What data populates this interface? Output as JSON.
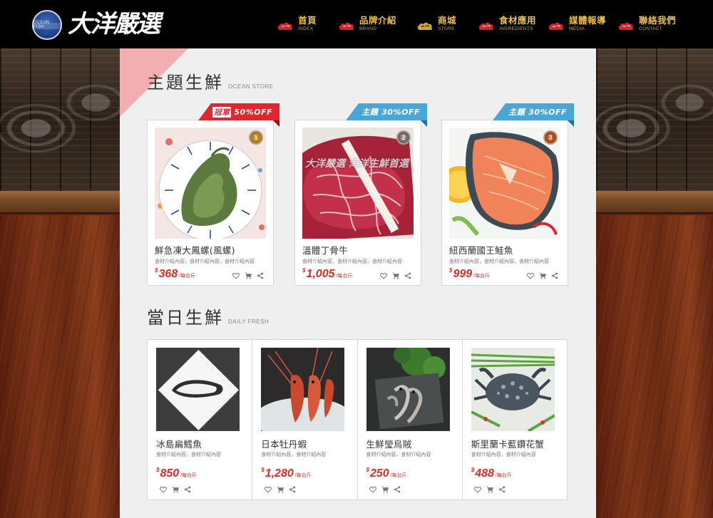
{
  "header": {
    "logo_badge_text": "OCEAN FISH",
    "logo_text": "大洋嚴選",
    "nav": [
      {
        "zh": "首頁",
        "en": "INDEX",
        "cloud": "red"
      },
      {
        "zh": "品牌介紹",
        "en": "BRAND",
        "cloud": "red"
      },
      {
        "zh": "商城",
        "en": "STORE",
        "cloud": "gold"
      },
      {
        "zh": "食材應用",
        "en": "INGREDIENTS",
        "cloud": "red"
      },
      {
        "zh": "媒體報導",
        "en": "MEDIA",
        "cloud": "red"
      },
      {
        "zh": "聯絡我們",
        "en": "CONTACT",
        "cloud": "red"
      }
    ]
  },
  "theme_section": {
    "title_zh": "主題生鮮",
    "title_en": "OCEAN STORE",
    "cards": [
      {
        "ribbon_prefix": "冠軍",
        "ribbon_text": "50%OFF",
        "ribbon_color": "#e0262f",
        "rank": "1",
        "name": "鮮急凍大鳳螺(風螺)",
        "desc": "食材介紹內容，食材介紹內容，食材介紹內容",
        "price": "368",
        "currency": "$",
        "unit": "/每台斤"
      },
      {
        "ribbon_prefix": "主題",
        "ribbon_text": "30%OFF",
        "ribbon_color": "#4aa6d6",
        "rank": "2",
        "name": "溫體丁骨牛",
        "desc": "食材介紹內容，食材介紹內容，食材介紹內容",
        "price": "1,005",
        "currency": "$",
        "unit": "/每台斤",
        "watermark": "大洋嚴選 海洋生鮮首選"
      },
      {
        "ribbon_prefix": "主題",
        "ribbon_text": "30%OFF",
        "ribbon_color": "#4aa6d6",
        "rank": "3",
        "name": "紐西蘭國王鮭魚",
        "desc": "食材介紹內容，食材介紹內容，食材介紹內容",
        "price": "999",
        "currency": "$",
        "unit": "/每台斤"
      }
    ]
  },
  "daily_section": {
    "title_zh": "當日生鮮",
    "title_en": "DAILY FRESH",
    "cards": [
      {
        "name": "冰島扁鱈魚",
        "desc": "食材介紹內容，食材介紹內容",
        "price": "850",
        "currency": "$",
        "unit": "/每台斤"
      },
      {
        "name": "日本牡丹蝦",
        "desc": "食材介紹內容，食材介紹內容",
        "price": "1,280",
        "currency": "$",
        "unit": "/每台斤"
      },
      {
        "name": "生鮮瑩烏賊",
        "desc": "食材介紹內容，食材介紹內容",
        "price": "250",
        "currency": "$",
        "unit": "/每台斤"
      },
      {
        "name": "斯里蘭卡藍鑽花蟹",
        "desc": "食材介紹內容，食材介紹內容",
        "price": "488",
        "currency": "$",
        "unit": "/每台斤"
      }
    ]
  },
  "icons": {
    "card_actions": [
      "heart-icon",
      "cart-icon",
      "share-icon"
    ],
    "nav_bullet": "cloud-icon"
  },
  "colors": {
    "header_bg": "#000000",
    "nav_text": "#f0c03a",
    "price": "#e22a25",
    "ribbon_red": "#e0262f",
    "ribbon_blue": "#4aa6d6",
    "panel_bg": "#efefef",
    "corner_accent": "#f2aeb0"
  }
}
